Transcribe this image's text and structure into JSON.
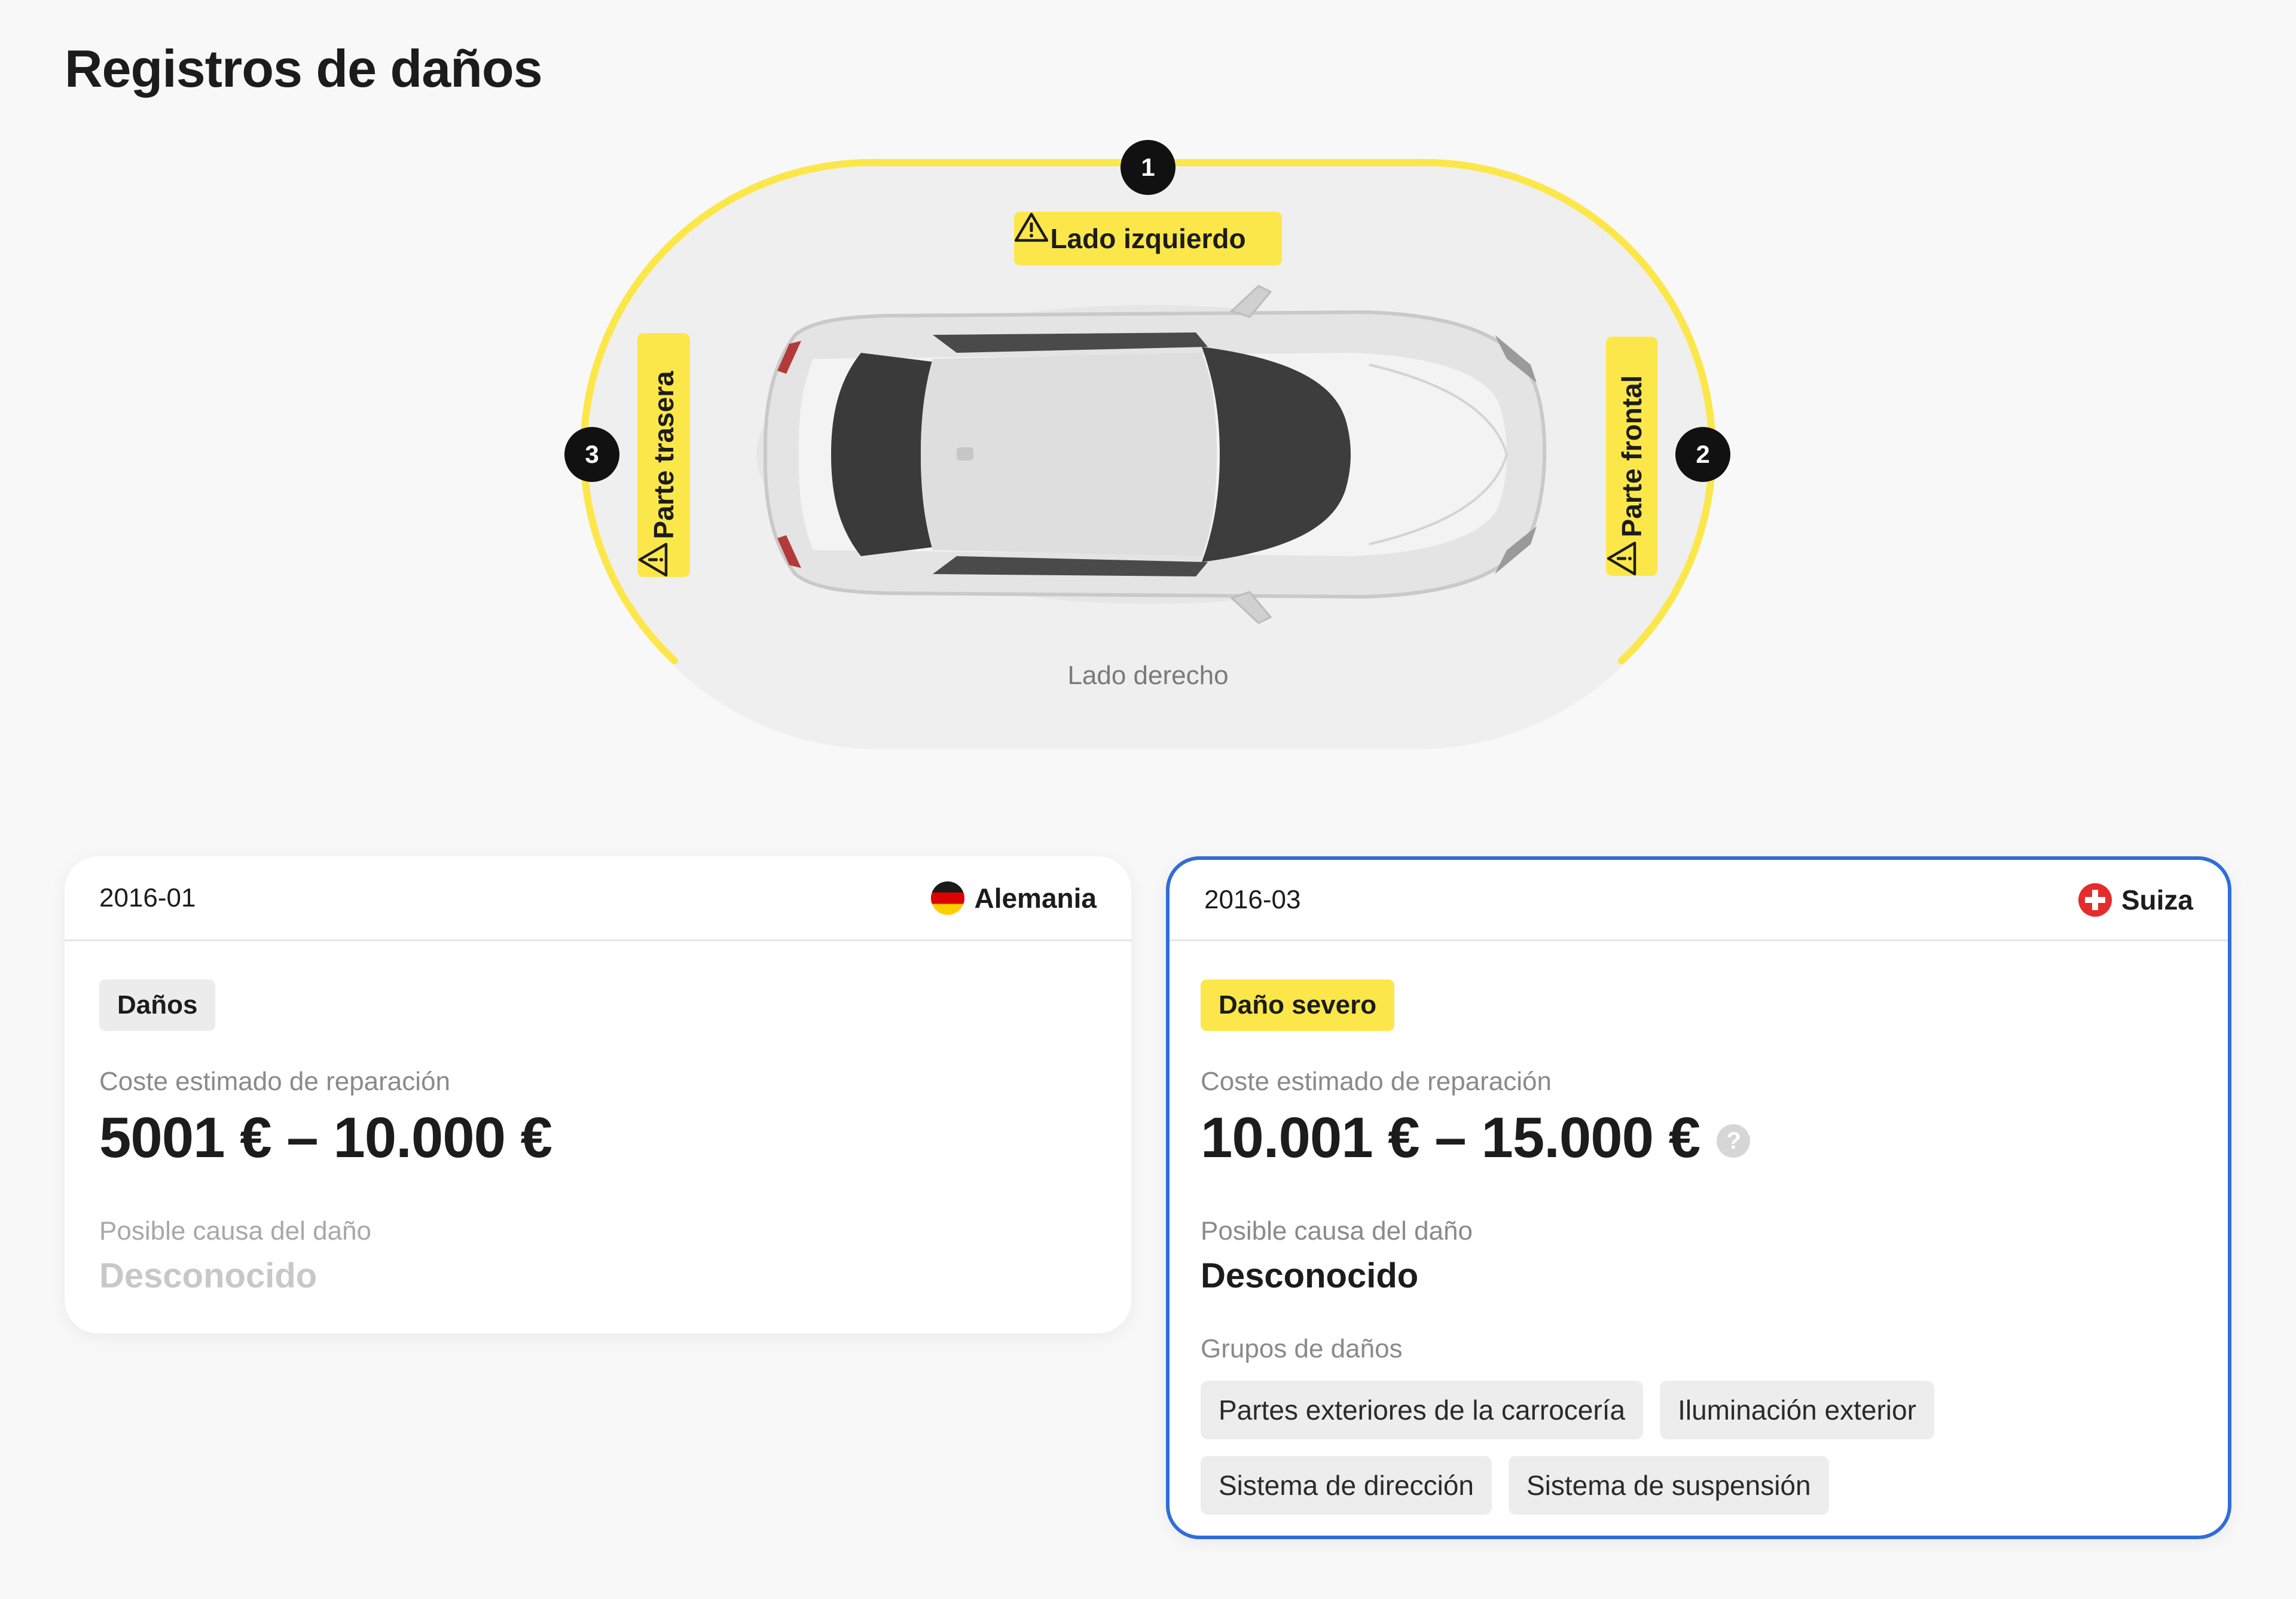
{
  "page": {
    "title": "Registros de daños"
  },
  "diagram": {
    "markers": [
      {
        "number": "1"
      },
      {
        "number": "2"
      },
      {
        "number": "3"
      }
    ],
    "zones": {
      "left_side": "Lado izquierdo",
      "front": "Parte frontal",
      "rear": "Parte trasera",
      "right_side": "Lado derecho"
    },
    "colors": {
      "highlight": "#fbe74a",
      "marker": "#111111",
      "zone_background": "#efefef"
    }
  },
  "records": [
    {
      "date": "2016-01",
      "country": "Alemania",
      "flag_icon": "germany-flag-icon",
      "severity": "Daños",
      "cost_label": "Coste estimado de reparación",
      "cost_value": "5001 € – 10.000 €",
      "cause_label": "Posible causa del daño",
      "cause_value": "Desconocido",
      "selected": false
    },
    {
      "date": "2016-03",
      "country": "Suiza",
      "flag_icon": "switzerland-flag-icon",
      "severity": "Daño severo",
      "cost_label": "Coste estimado de reparación",
      "cost_value": "10.001 € – 15.000 €",
      "help_icon": "?",
      "cause_label": "Posible causa del daño",
      "cause_value": "Desconocido",
      "groups_label": "Grupos de daños",
      "groups": [
        "Partes exteriores de la carrocería",
        "Iluminación exterior",
        "Sistema de dirección",
        "Sistema de suspensión"
      ],
      "selected": true,
      "accent_color": "#2f6ed8"
    }
  ]
}
